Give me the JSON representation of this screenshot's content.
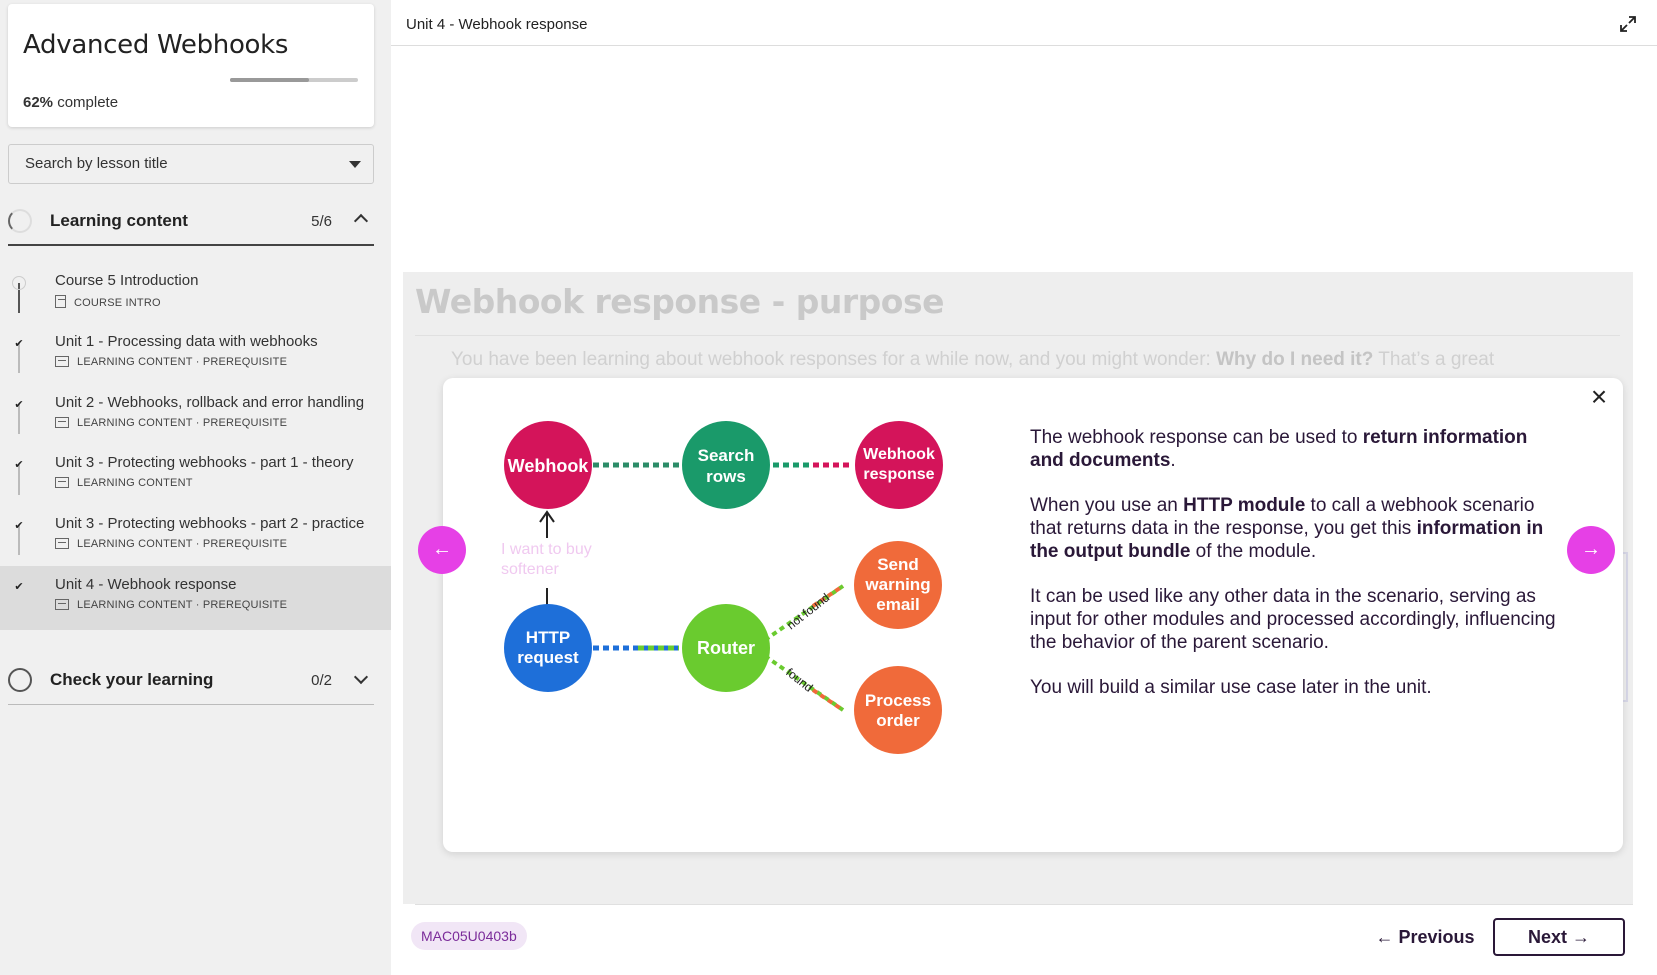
{
  "course": {
    "title": "Advanced Webhooks",
    "progress_percent": 62,
    "progress_value": "62%",
    "progress_label": "complete"
  },
  "search": {
    "label": "Search by lesson title"
  },
  "sections": [
    {
      "title": "Learning content",
      "count": "5/6",
      "expanded": true
    },
    {
      "title": "Check your learning",
      "count": "0/2",
      "expanded": false
    }
  ],
  "lessons": [
    {
      "title": "Course 5 Introduction",
      "meta": "COURSE INTRO",
      "done": false
    },
    {
      "title": "Unit 1 - Processing data with webhooks",
      "meta": "LEARNING CONTENT · PREREQUISITE",
      "done": true
    },
    {
      "title": "Unit 2 - Webhooks, rollback and error handling",
      "meta": "LEARNING CONTENT · PREREQUISITE",
      "done": true
    },
    {
      "title": "Unit 3 - Protecting webhooks - part 1 - theory",
      "meta": "LEARNING CONTENT",
      "done": true
    },
    {
      "title": "Unit 3 - Protecting webhooks - part 2 - practice",
      "meta": "LEARNING CONTENT · PREREQUISITE",
      "done": true
    },
    {
      "title": "Unit 4 - Webhook response",
      "meta": "LEARNING CONTENT · PREREQUISITE",
      "done": true,
      "active": true
    }
  ],
  "topbar": {
    "title": "Unit 4 - Webhook response"
  },
  "background": {
    "heading": "Webhook response - purpose",
    "text_plain": "You have been learning about webhook responses for a while now, and you might wonder: ",
    "text_bold": "Why do I need it?",
    "text_tail": " That’s a great"
  },
  "diagram": {
    "nodes": {
      "webhook": "Webhook",
      "search_rows_1": "Search",
      "search_rows_2": "rows",
      "webhook_response_1": "Webhook",
      "webhook_response_2": "response",
      "http_1": "HTTP",
      "http_2": "request",
      "router": "Router",
      "warning_1": "Send",
      "warning_2": "warning",
      "warning_3": "email",
      "process_1": "Process",
      "process_2": "order"
    },
    "edge_not_found": "not found",
    "edge_found": "found",
    "buy_text_1": "I want to buy",
    "buy_text_2": "softener",
    "colors": {
      "webhook": "#d4145a",
      "search": "#1a9a6a",
      "http": "#1e6fd9",
      "router": "#6acb2f",
      "orange": "#f06a3a"
    }
  },
  "modal": {
    "p1_a": "The webhook response can be used to ",
    "p1_b": "return information and documents",
    "p1_c": ".",
    "p2_a": "When you use an ",
    "p2_b": "HTTP module",
    "p2_c": " to call a webhook scenario that returns data in the response, you get this ",
    "p2_d": "information in the output bundle",
    "p2_e": " of the module.",
    "p3": "It can be used like any other data in the scenario, serving as input for other modules and processed accordingly, influencing the behavior of the parent scenario.",
    "p4": "You will build a similar use case later in the unit.",
    "close": "×"
  },
  "nav": {
    "prev_arrow": "←",
    "next_arrow": "→"
  },
  "footer": {
    "code": "MAC05U0403b",
    "previous": "← Previous",
    "next": "Next →"
  },
  "icons": {
    "expand": "expand-icon",
    "check": "check-icon",
    "chevron_up": "chevron-up-icon",
    "chevron_down": "chevron-down-icon"
  }
}
